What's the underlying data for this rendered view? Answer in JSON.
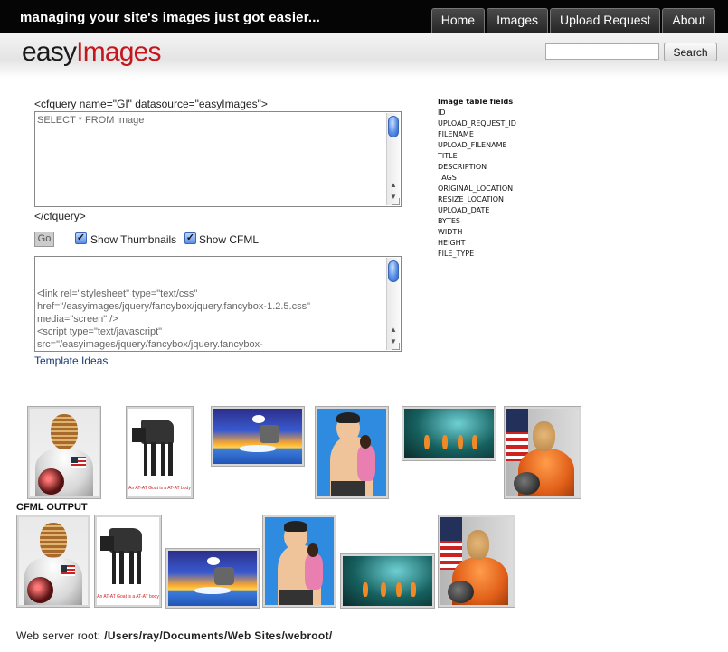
{
  "topbar": {
    "tagline": "managing your site's images just got easier...",
    "nav": [
      "Home",
      "Images",
      "Upload Request",
      "About"
    ]
  },
  "header": {
    "logo_part1": "easy",
    "logo_part2": "Images",
    "search_value": "",
    "search_button": "Search"
  },
  "query": {
    "open_tag": "<cfquery name=\"GI\" datasource=\"easyImages\">",
    "sql": "SELECT * FROM image",
    "close_tag": "</cfquery>"
  },
  "controls": {
    "go_label": "Go",
    "show_thumbnails_label": "Show Thumbnails",
    "show_thumbnails_checked": true,
    "show_cfml_label": "Show CFML",
    "show_cfml_checked": true
  },
  "template": {
    "code": "<link rel=\"stylesheet\" type=\"text/css\"\nhref=\"/easyimages/jquery/fancybox/jquery.fancybox-1.2.5.css\"\nmedia=\"screen\" />\n<script type=\"text/javascript\"\nsrc=\"/easyimages/jquery/fancybox/jquery.fancybox-",
    "ideas_link": "Template Ideas"
  },
  "fields": {
    "title": "Image table fields",
    "items": [
      "ID",
      "UPLOAD_REQUEST_ID",
      "FILENAME",
      "UPLOAD_FILENAME",
      "TITLE",
      "DESCRIPTION",
      "TAGS",
      "ORIGINAL_LOCATION",
      "RESIZE_LOCATION",
      "UPLOAD_DATE",
      "BYTES",
      "WIDTH",
      "HEIGHT",
      "FILE_TYPE"
    ]
  },
  "thumbnails": {
    "atat_caption": "An AT-AT Goat is a AT-AT body"
  },
  "output": {
    "label": "CFML OUTPUT"
  },
  "footer": {
    "label": "Web server root:",
    "path": "/Users/ray/Documents/Web Sites/webroot/"
  },
  "colors": {
    "topbar": "#050505",
    "logo_accent": "#c4161c",
    "link": "#1c3b73"
  }
}
